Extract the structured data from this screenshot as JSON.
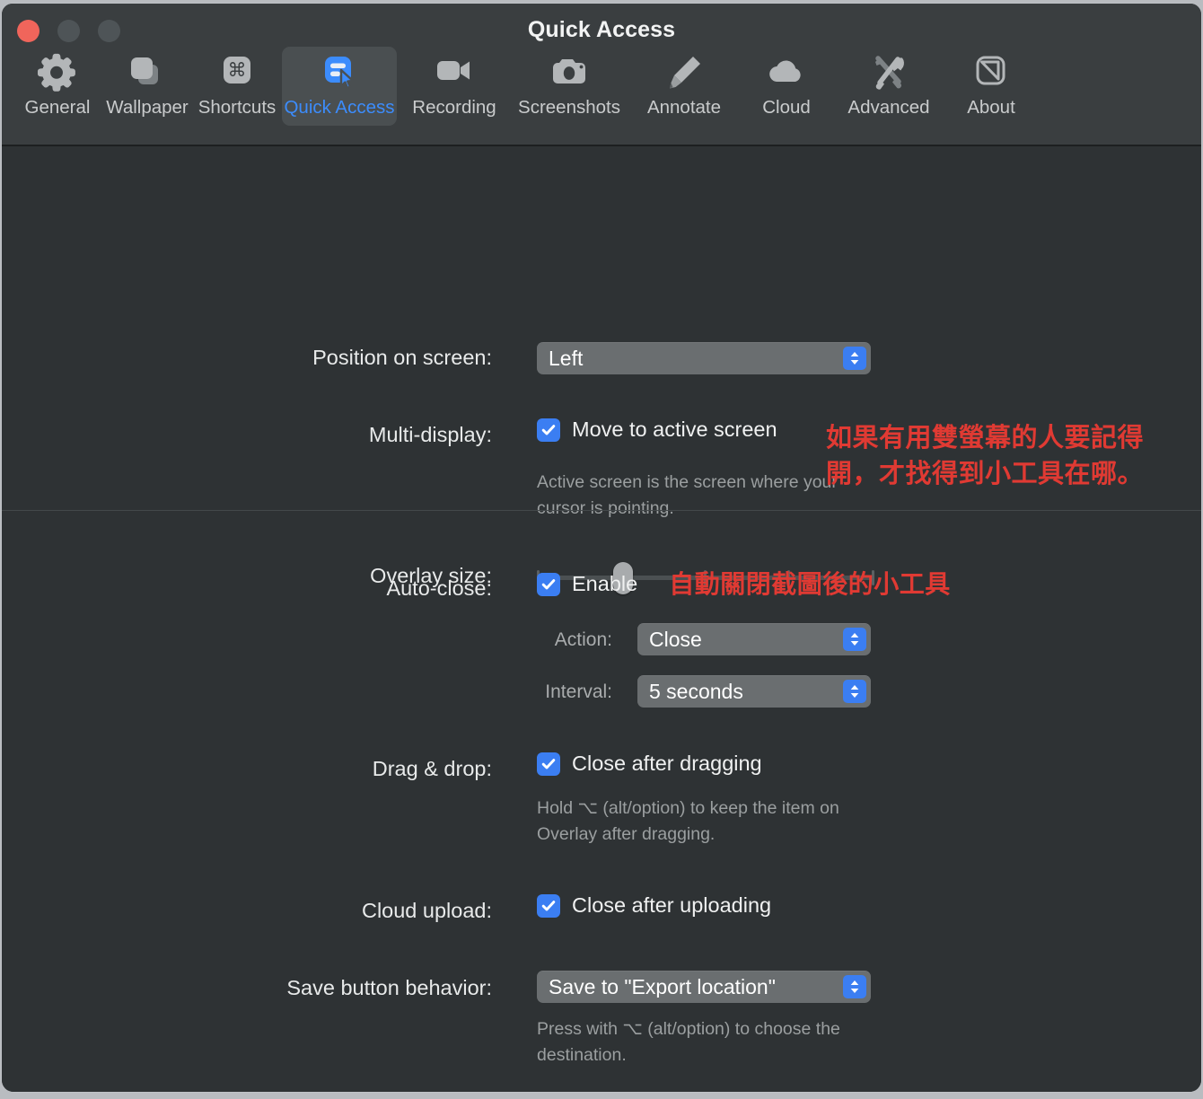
{
  "window": {
    "title": "Quick Access",
    "traffic_lights": [
      "close",
      "minimize",
      "zoom"
    ]
  },
  "toolbar": {
    "tabs": [
      {
        "label": "General",
        "icon": "gear-icon",
        "selected": false
      },
      {
        "label": "Wallpaper",
        "icon": "wallpaper-icon",
        "selected": false
      },
      {
        "label": "Shortcuts",
        "icon": "command-key-icon",
        "selected": false
      },
      {
        "label": "Quick Access",
        "icon": "quick-access-icon",
        "selected": true
      },
      {
        "label": "Recording",
        "icon": "video-camera-icon",
        "selected": false
      },
      {
        "label": "Screenshots",
        "icon": "camera-icon",
        "selected": false
      },
      {
        "label": "Annotate",
        "icon": "marker-pen-icon",
        "selected": false
      },
      {
        "label": "Cloud",
        "icon": "cloud-icon",
        "selected": false
      },
      {
        "label": "Advanced",
        "icon": "tools-icon",
        "selected": false
      },
      {
        "label": "About",
        "icon": "app-logo-icon",
        "selected": false
      }
    ]
  },
  "section_top": {
    "position": {
      "label": "Position on screen:",
      "value": "Left"
    },
    "multi_display": {
      "label": "Multi-display:",
      "checkbox_label": "Move to active screen",
      "checked": true,
      "help": "Active screen is the screen where your cursor is pointing.",
      "annotation": "如果有用雙螢幕的人要記得開，才找得到小工具在哪。"
    },
    "overlay_size": {
      "label": "Overlay size:",
      "ticks": 5,
      "value_index": 1
    }
  },
  "section_bottom": {
    "auto_close": {
      "label": "Auto-close:",
      "checkbox_label": "Enable",
      "checked": true,
      "annotation": "自動關閉截圖後的小工具",
      "action_label": "Action:",
      "action_value": "Close",
      "interval_label": "Interval:",
      "interval_value": "5 seconds"
    },
    "drag_drop": {
      "label": "Drag & drop:",
      "checkbox_label": "Close after dragging",
      "checked": true,
      "help": "Hold ⌥ (alt/option) to keep the item on Overlay after dragging."
    },
    "cloud_upload": {
      "label": "Cloud upload:",
      "checkbox_label": "Close after uploading",
      "checked": true
    },
    "save_behavior": {
      "label": "Save button behavior:",
      "value": "Save to \"Export location\"",
      "help": "Press with ⌥ (alt/option) to choose the destination."
    }
  },
  "colors": {
    "accent": "#3b7ef2",
    "annotation": "#e03a33",
    "window_bg": "#2e3234",
    "titlebar_bg": "#3a3e40",
    "close_light": "#f0655b"
  }
}
